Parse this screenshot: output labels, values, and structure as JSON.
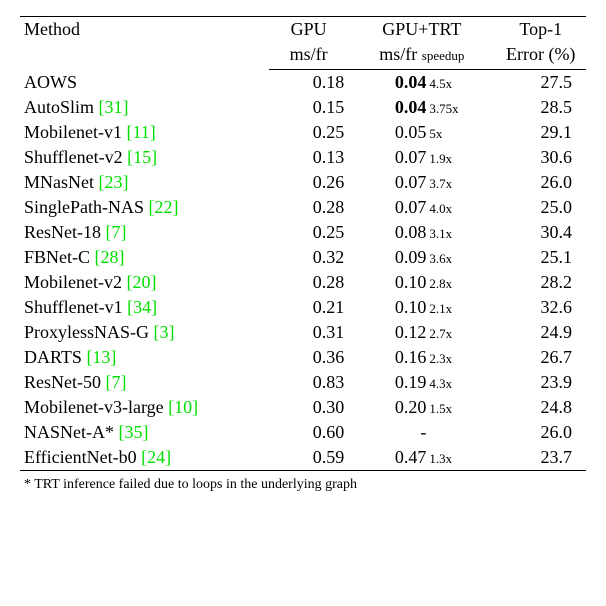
{
  "header": {
    "method": "Method",
    "gpu_top": "GPU",
    "gpu_bot": "ms/fr",
    "trt_top": "GPU+TRT",
    "trt_bot_main": "ms/fr",
    "trt_bot_sub": "speedup",
    "err_top": "Top-1",
    "err_bot": "Error (%)"
  },
  "rows": [
    {
      "method": "AOWS",
      "cite": "",
      "gpu": "0.18",
      "trt": "0.04",
      "trt_bold": true,
      "speed": "4.5x",
      "err": "27.5"
    },
    {
      "method": "AutoSlim",
      "cite": "[31]",
      "gpu": "0.15",
      "trt": "0.04",
      "trt_bold": true,
      "speed": "3.75x",
      "err": "28.5"
    },
    {
      "method": "Mobilenet-v1",
      "cite": "[11]",
      "gpu": "0.25",
      "trt": "0.05",
      "trt_bold": false,
      "speed": "5x",
      "err": "29.1"
    },
    {
      "method": "Shufflenet-v2",
      "cite": "[15]",
      "gpu": "0.13",
      "trt": "0.07",
      "trt_bold": false,
      "speed": "1.9x",
      "err": "30.6"
    },
    {
      "method": "MNasNet",
      "cite": "[23]",
      "gpu": "0.26",
      "trt": "0.07",
      "trt_bold": false,
      "speed": "3.7x",
      "err": "26.0"
    },
    {
      "method": "SinglePath-NAS",
      "cite": "[22]",
      "gpu": "0.28",
      "trt": "0.07",
      "trt_bold": false,
      "speed": "4.0x",
      "err": "25.0"
    },
    {
      "method": "ResNet-18",
      "cite": "[7]",
      "gpu": "0.25",
      "trt": "0.08",
      "trt_bold": false,
      "speed": "3.1x",
      "err": "30.4"
    },
    {
      "method": "FBNet-C",
      "cite": "[28]",
      "gpu": "0.32",
      "trt": "0.09",
      "trt_bold": false,
      "speed": "3.6x",
      "err": "25.1"
    },
    {
      "method": "Mobilenet-v2",
      "cite": "[20]",
      "gpu": "0.28",
      "trt": "0.10",
      "trt_bold": false,
      "speed": "2.8x",
      "err": "28.2"
    },
    {
      "method": "Shufflenet-v1",
      "cite": "[34]",
      "gpu": "0.21",
      "trt": "0.10",
      "trt_bold": false,
      "speed": "2.1x",
      "err": "32.6"
    },
    {
      "method": "ProxylessNAS-G",
      "cite": "[3]",
      "gpu": "0.31",
      "trt": "0.12",
      "trt_bold": false,
      "speed": "2.7x",
      "err": "24.9"
    },
    {
      "method": "DARTS",
      "cite": "[13]",
      "gpu": "0.36",
      "trt": "0.16",
      "trt_bold": false,
      "speed": "2.3x",
      "err": "26.7"
    },
    {
      "method": "ResNet-50",
      "cite": "[7]",
      "gpu": "0.83",
      "trt": "0.19",
      "trt_bold": false,
      "speed": "4.3x",
      "err": "23.9"
    },
    {
      "method": "Mobilenet-v3-large",
      "cite": "[10]",
      "gpu": "0.30",
      "trt": "0.20",
      "trt_bold": false,
      "speed": "1.5x",
      "err": "24.8"
    },
    {
      "method": "NASNet-A*",
      "cite": "[35]",
      "gpu": "0.60",
      "trt": "-",
      "trt_bold": false,
      "speed": "",
      "err": "26.0"
    },
    {
      "method": "EfficientNet-b0",
      "cite": "[24]",
      "gpu": "0.59",
      "trt": "0.47",
      "trt_bold": false,
      "speed": "1.3x",
      "err": "23.7"
    }
  ],
  "footnote": "* TRT inference failed due to loops in the underlying graph"
}
